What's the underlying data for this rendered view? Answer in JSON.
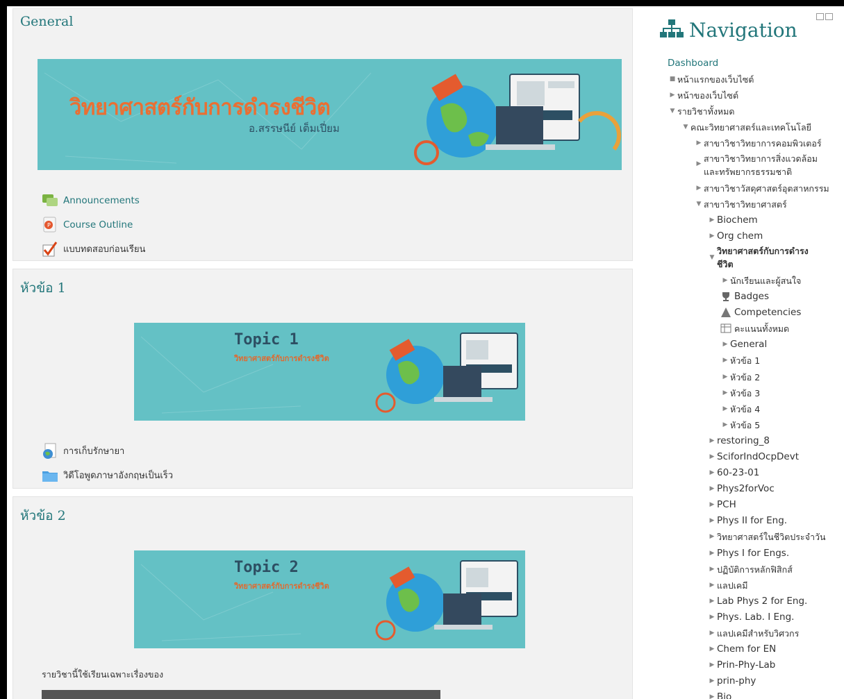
{
  "sections": {
    "general": {
      "title": "General",
      "banner_title": "วิทยาศาสตร์กับการดำรงชีวิต",
      "banner_author": "อ.สรรษนีย์ เต็มเปี่ยม",
      "activities": [
        "Announcements",
        "Course Outline",
        "แบบทดสอบก่อนเรียน"
      ]
    },
    "topic1": {
      "title": "หัวข้อ 1",
      "banner_en": "Topic 1",
      "banner_th": "วิทยาศาสตร์กับการดำรงชีวิต",
      "activities": [
        "การเก็บรักษายา",
        "วิดีโอพูดภาษาอังกฤษเป็นเร็ว"
      ]
    },
    "topic2": {
      "title": "หัวข้อ 2",
      "banner_en": "Topic 2",
      "banner_th": "วิทยาศาสตร์กับการดำรงชีวิต",
      "summary": "รายวิชานี้ใช้เรียนเฉพาะเรื่องของ"
    }
  },
  "nav": {
    "title": "Navigation",
    "items": [
      "Dashboard",
      "หน้าแรกของเว็บไซต์",
      "หน้าของเว็บไซต์",
      "รายวิชาทั้งหมด",
      "คณะวิทยาศาสตร์และเทคโนโลยี",
      "สาขาวิชาวิทยาการคอมพิวเตอร์",
      "สาขาวิชาวิทยาการสิ่งแวดล้อม",
      "และทรัพยากรธรรมชาติ",
      "สาขาวิชาวัสดุศาสตร์อุตสาหกรรม",
      "สาขาวิชาวิทยาศาสตร์",
      "Biochem",
      "Org chem",
      "วิทยาศาสตร์กับการดำรง",
      "ชีวิต",
      "นักเรียนและผู้สนใจ",
      "Badges",
      "Competencies",
      "คะแนนทั้งหมด",
      "General",
      "หัวข้อ 1",
      "หัวข้อ 2",
      "หัวข้อ 3",
      "หัวข้อ 4",
      "หัวข้อ 5",
      "restoring_8",
      "SciforIndOcpDevt",
      "60-23-01",
      "Phys2forVoc",
      "PCH",
      "Phys II for Eng.",
      "วิทยาศาสตร์ในชีวิตประจำวัน",
      "Phys I for Engs.",
      "ปฏิบัติการหลักฟิสิกส์",
      "แลปเคมี",
      "Lab Phys 2 for Eng.",
      "Phys. Lab. I Eng.",
      "แลปเคมีสำหรับวิศวกร",
      "Chem for EN",
      "Prin-Phy-Lab",
      "prin-phy",
      "Bio"
    ]
  },
  "colors": {
    "accent": "#22767a",
    "banner": "#64c1c5",
    "banner_title": "#ea6f33"
  }
}
